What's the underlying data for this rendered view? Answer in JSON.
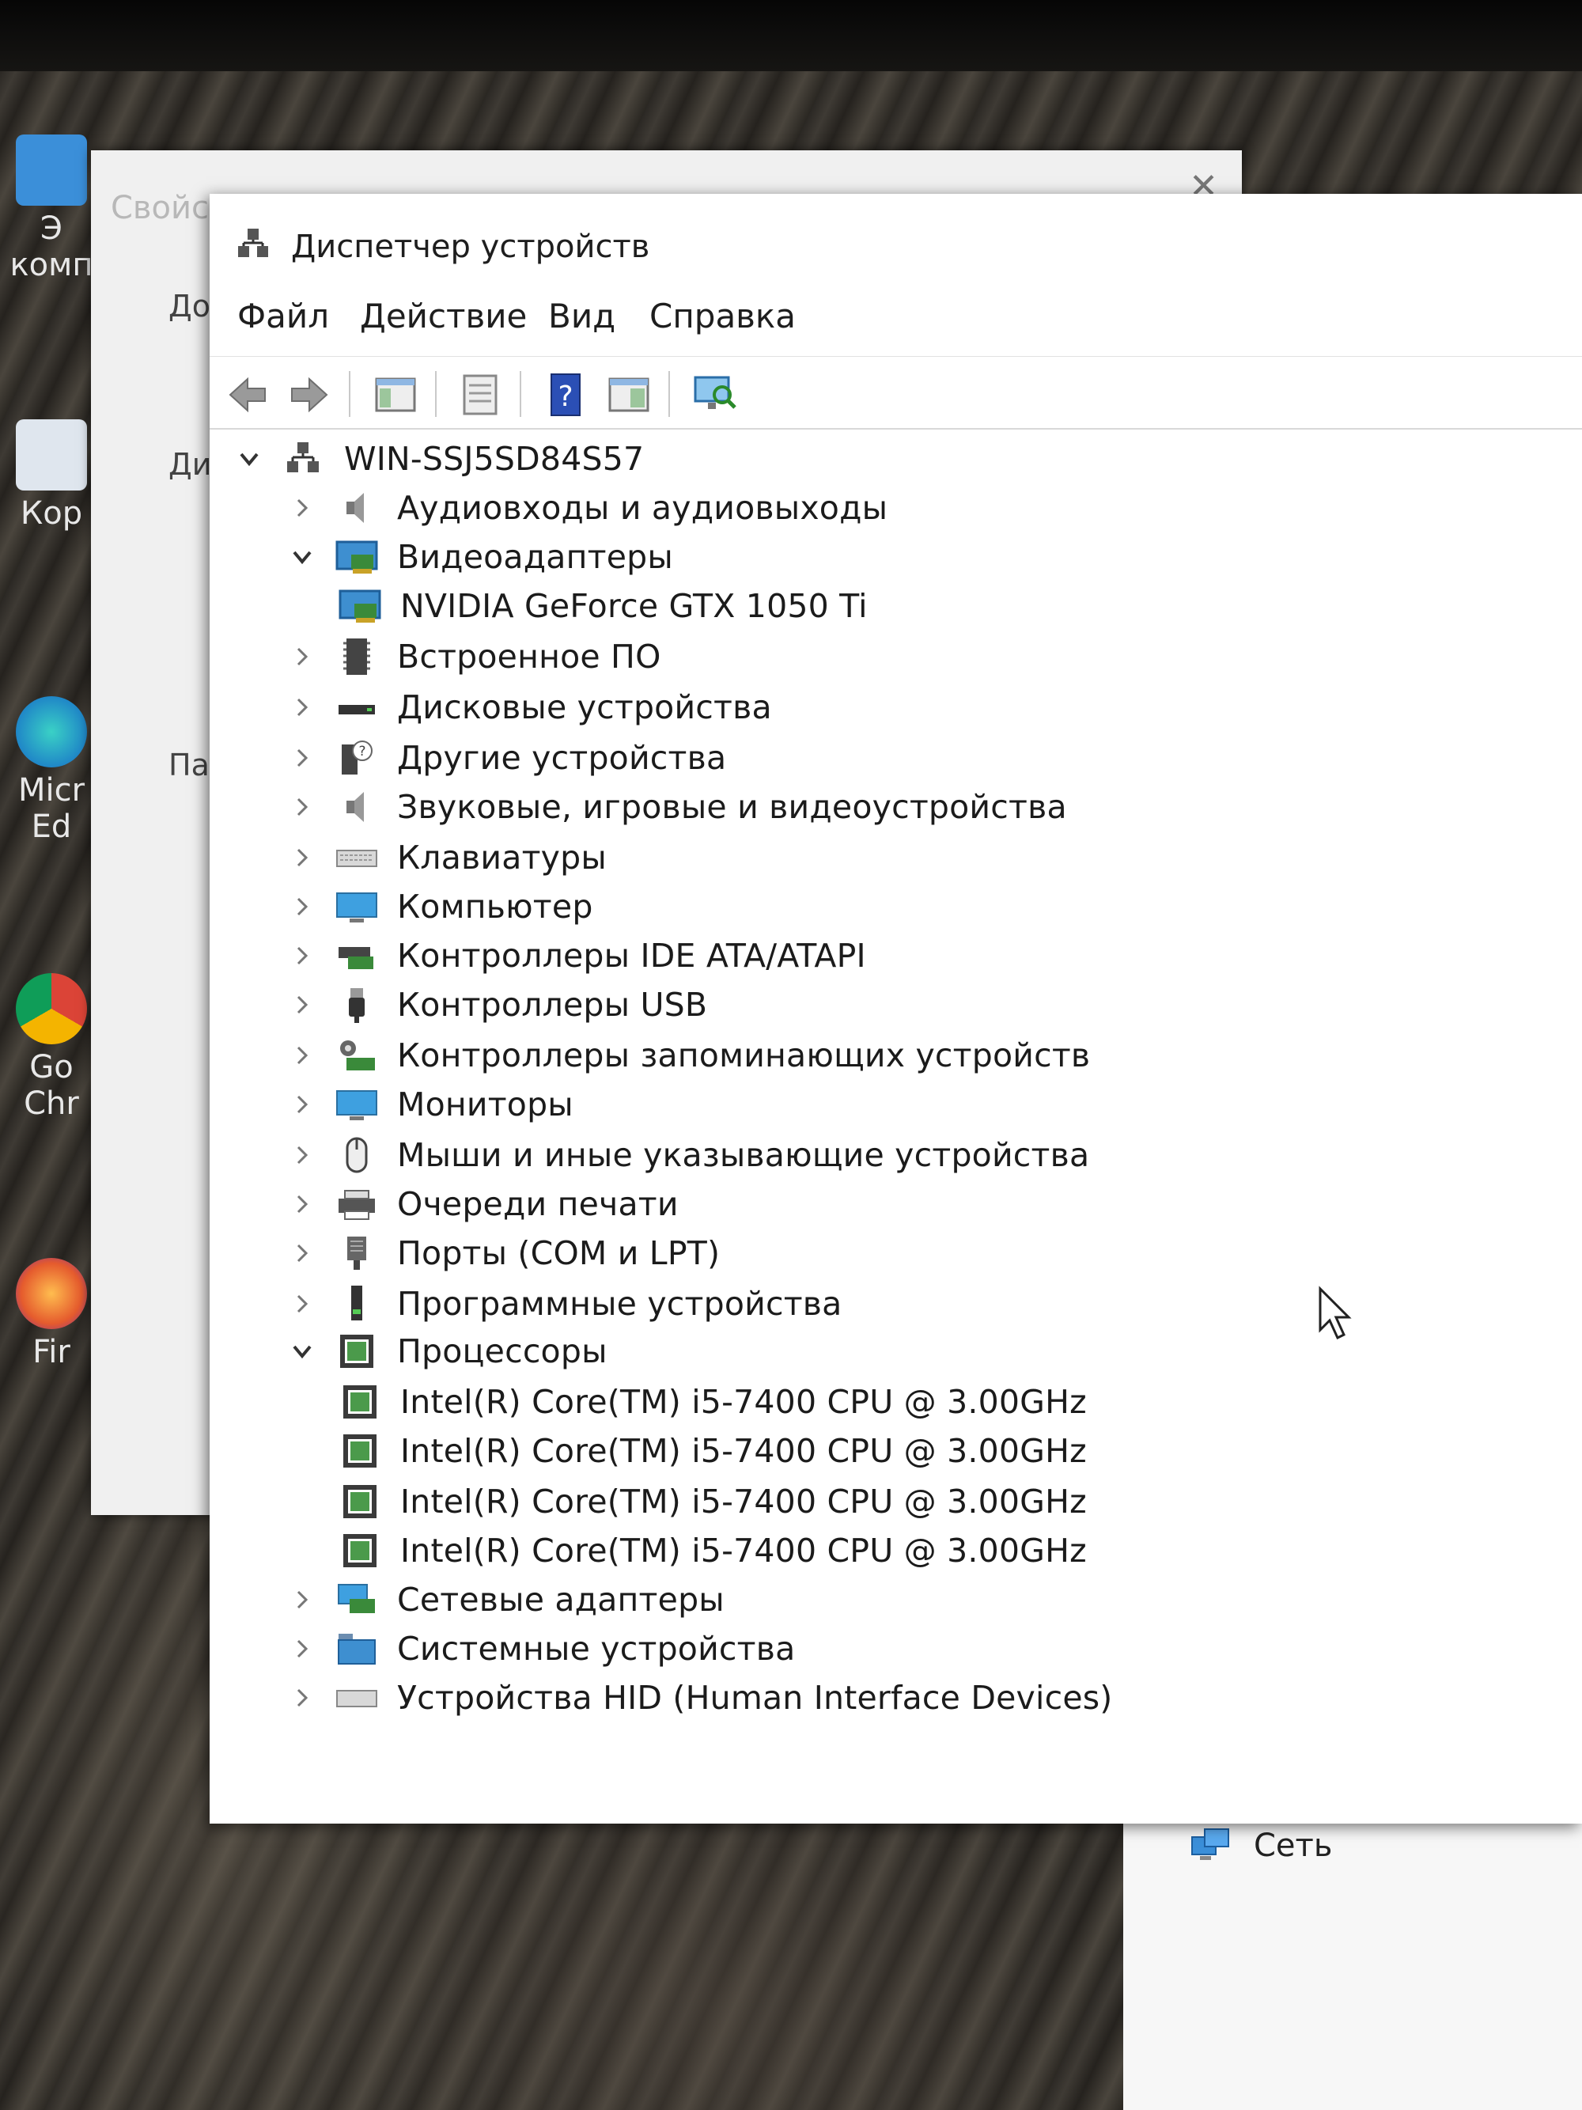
{
  "back_window": {
    "title": "Свойства системы",
    "labels": [
      "До",
      "Ди",
      "Па"
    ],
    "network_label": "Сеть"
  },
  "desktop": {
    "icons": [
      "Э комп",
      "Кор",
      "Micr Ed",
      "Go Chr",
      "Fir"
    ]
  },
  "window": {
    "title": "Диспетчер устройств"
  },
  "menu": [
    "Файл",
    "Действие",
    "Вид",
    "Справка"
  ],
  "toolbar": {
    "buttons": [
      "back-icon",
      "forward-icon",
      "show-hide-console-tree-icon",
      "properties-icon",
      "help-icon",
      "view-icon",
      "scan-hardware-icon"
    ]
  },
  "tree": {
    "root": "WIN-SSJ5SD84S57",
    "items": [
      {
        "label": "Аудиовходы и аудиовыходы",
        "icon": "speaker-icon",
        "expanded": false
      },
      {
        "label": "Видеоадаптеры",
        "icon": "display-adapter-icon",
        "expanded": true
      },
      {
        "label": "NVIDIA GeForce GTX 1050 Ti",
        "icon": "display-adapter-icon",
        "child": true
      },
      {
        "label": "Встроенное ПО",
        "icon": "firmware-icon",
        "expanded": false
      },
      {
        "label": "Дисковые устройства",
        "icon": "disk-icon",
        "expanded": false
      },
      {
        "label": "Другие устройства",
        "icon": "unknown-device-icon",
        "expanded": false
      },
      {
        "label": "Звуковые, игровые и видеоустройства",
        "icon": "speaker-icon",
        "expanded": false
      },
      {
        "label": "Клавиатуры",
        "icon": "keyboard-icon",
        "expanded": false
      },
      {
        "label": "Компьютер",
        "icon": "computer-icon",
        "expanded": false
      },
      {
        "label": "Контроллеры IDE ATA/ATAPI",
        "icon": "ide-controller-icon",
        "expanded": false
      },
      {
        "label": "Контроллеры USB",
        "icon": "usb-icon",
        "expanded": false
      },
      {
        "label": "Контроллеры запоминающих устройств",
        "icon": "storage-controller-icon",
        "expanded": false
      },
      {
        "label": "Мониторы",
        "icon": "monitor-icon",
        "expanded": false
      },
      {
        "label": "Мыши и иные указывающие устройства",
        "icon": "mouse-icon",
        "expanded": false
      },
      {
        "label": "Очереди печати",
        "icon": "printer-icon",
        "expanded": false
      },
      {
        "label": "Порты (COM и LPT)",
        "icon": "port-icon",
        "expanded": false
      },
      {
        "label": "Программные устройства",
        "icon": "software-device-icon",
        "expanded": false
      },
      {
        "label": "Процессоры",
        "icon": "processor-icon",
        "expanded": true
      },
      {
        "label": "Intel(R) Core(TM) i5-7400 CPU @ 3.00GHz",
        "icon": "processor-icon",
        "child": true
      },
      {
        "label": "Intel(R) Core(TM) i5-7400 CPU @ 3.00GHz",
        "icon": "processor-icon",
        "child": true
      },
      {
        "label": "Intel(R) Core(TM) i5-7400 CPU @ 3.00GHz",
        "icon": "processor-icon",
        "child": true
      },
      {
        "label": "Intel(R) Core(TM) i5-7400 CPU @ 3.00GHz",
        "icon": "processor-icon",
        "child": true
      },
      {
        "label": "Сетевые адаптеры",
        "icon": "network-adapter-icon",
        "expanded": false
      },
      {
        "label": "Системные устройства",
        "icon": "system-device-icon",
        "expanded": false
      },
      {
        "label": "Устройства HID (Human Interface Devices)",
        "icon": "hid-icon",
        "expanded": false
      }
    ]
  }
}
